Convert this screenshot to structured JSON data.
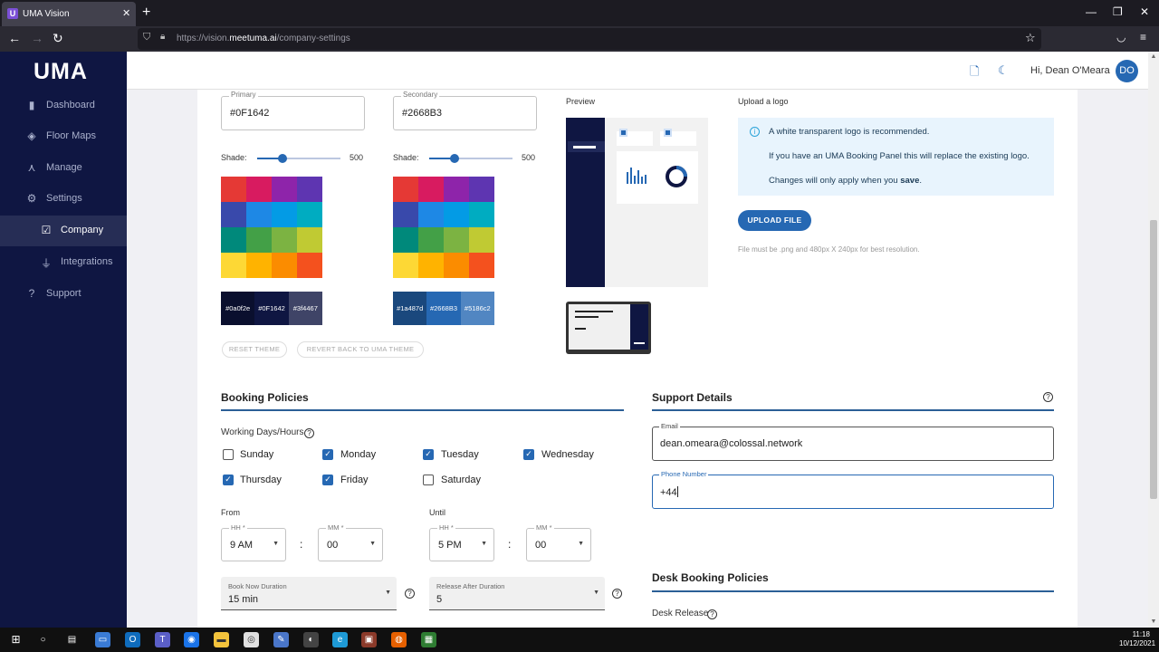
{
  "browser": {
    "tab_title": "UMA Vision",
    "tab_favicon": "U",
    "url_prefix": "https://vision.",
    "url_domain": "meetuma.ai",
    "url_path": "/company-settings"
  },
  "sidebar": {
    "logo": "UMA",
    "items": [
      {
        "label": "Dashboard",
        "icon": "bar-chart-icon"
      },
      {
        "label": "Floor Maps",
        "icon": "map-icon"
      },
      {
        "label": "Manage",
        "icon": "hierarchy-icon"
      },
      {
        "label": "Settings",
        "icon": "gear-icon"
      },
      {
        "label": "Company",
        "icon": "calendar-check-icon"
      },
      {
        "label": "Integrations",
        "icon": "plug-icon"
      },
      {
        "label": "Support",
        "icon": "help-icon"
      }
    ]
  },
  "topbar": {
    "greeting": "Hi, Dean O'Meara",
    "avatar_initials": "DO"
  },
  "theme": {
    "primary_label": "Primary",
    "primary_value": "#0F1642",
    "secondary_label": "Secondary",
    "secondary_value": "#2668B3",
    "shade_label": "Shade:",
    "primary_shade": "500",
    "secondary_shade": "500",
    "shade_fraction": 0.3,
    "palette_colors": [
      "#e53935",
      "#d81b60",
      "#8e24aa",
      "#5e35b1",
      "#3949ab",
      "#1e88e5",
      "#039be5",
      "#00acc1",
      "#00897b",
      "#43a047",
      "#7cb342",
      "#c0ca33",
      "#fdd835",
      "#ffb300",
      "#fb8c00",
      "#f4511e"
    ],
    "primary_shades": [
      "#0a0f2e",
      "#0F1642",
      "#3f4467"
    ],
    "secondary_shades": [
      "#1a487d",
      "#2668B3",
      "#5186c2"
    ],
    "reset_label": "RESET THEME",
    "revert_label": "REVERT BACK TO UMA THEME"
  },
  "preview": {
    "title": "Preview"
  },
  "logo_upload": {
    "title": "Upload a logo",
    "info_line1": "A white transparent logo is recommended.",
    "info_line2": "If you have an UMA Booking Panel this will replace the existing logo.",
    "info_line3_prefix": "Changes will only apply when you ",
    "info_line3_bold": "save",
    "info_line3_suffix": ".",
    "button": "UPLOAD FILE",
    "hint": "File must be .png and 480px X 240px for best resolution."
  },
  "booking": {
    "title": "Booking Policies",
    "working_label": "Working Days/Hours",
    "days": [
      {
        "label": "Sunday",
        "checked": false
      },
      {
        "label": "Monday",
        "checked": true
      },
      {
        "label": "Tuesday",
        "checked": true
      },
      {
        "label": "Wednesday",
        "checked": true
      },
      {
        "label": "Thursday",
        "checked": true
      },
      {
        "label": "Friday",
        "checked": true
      },
      {
        "label": "Saturday",
        "checked": false
      }
    ],
    "from_label": "From",
    "until_label": "Until",
    "hh_label": "HH *",
    "mm_label": "MM *",
    "from_hh": "9 AM",
    "from_mm": "00",
    "until_hh": "5 PM",
    "until_mm": "00",
    "colon": ":",
    "book_now_label": "Book Now Duration",
    "book_now_value": "15 min",
    "release_label": "Release After Duration",
    "release_value": "5"
  },
  "support": {
    "title": "Support Details",
    "email_label": "Email",
    "email_value": "dean.omeara@colossal.network",
    "phone_label": "Phone Number",
    "phone_value": "+44"
  },
  "desk": {
    "title": "Desk Booking Policies",
    "release_label": "Desk Release"
  },
  "taskbar": {
    "time": "11:18",
    "date": "10/12/2021"
  },
  "colors": {
    "brand_primary": "#0F1642",
    "brand_secondary": "#2668B3"
  }
}
